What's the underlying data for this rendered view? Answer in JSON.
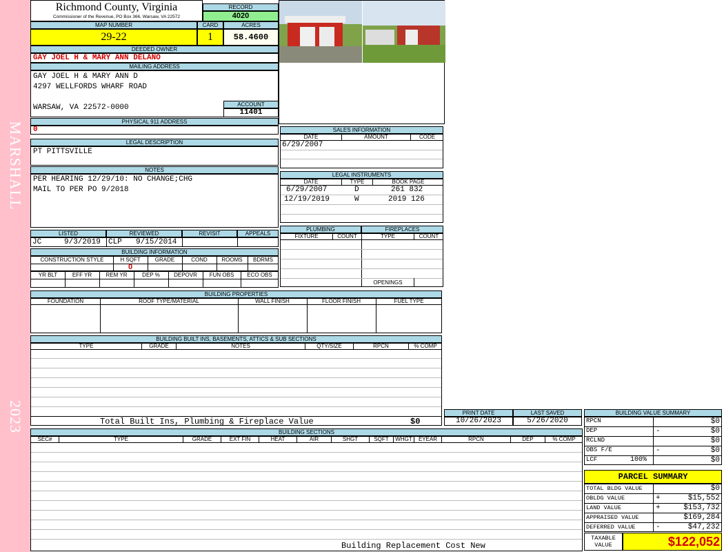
{
  "sidebar": {
    "district": "MARSHALL",
    "year": "2023"
  },
  "header": {
    "county": "Richmond County, Virginia",
    "commissioner": "Commissioner of the Revenue, PO Box 366, Warsaw, VA 22572",
    "record_label": "RECORD",
    "record": "4020",
    "map_label": "MAP NUMBER",
    "map_number": "29-22",
    "card_label": "CARD",
    "card": "1",
    "acres_label": "ACRES",
    "acres": "58.4600"
  },
  "owner": {
    "label": "DEEDED OWNER",
    "name": "GAY JOEL H & MARY ANN DELANO"
  },
  "mailing": {
    "label": "MAILING ADDRESS",
    "line1": "GAY JOEL H & MARY ANN D",
    "line2": "4297 WELLFORDS WHARF ROAD",
    "line3": "WARSAW, VA 22572-0000",
    "account_label": "ACCOUNT",
    "account": "11401"
  },
  "physical": {
    "label": "PHYSICAL 911 ADDRESS",
    "value": "0"
  },
  "legal": {
    "label": "LEGAL DESCRIPTION",
    "value": "PT PITTSVILLE"
  },
  "notes": {
    "label": "NOTES",
    "line1": "PER HEARING 12/29/10: NO CHANGE;CHG",
    "line2": "MAIL TO PER PO 9/2018"
  },
  "listed": {
    "listed_label": "LISTED",
    "reviewed_label": "REVIEWED",
    "revisit_label": "REVISIT",
    "appeals_label": "APPEALS",
    "listed_by": "JC",
    "listed_date": "9/3/2019",
    "reviewed_by": "CLP",
    "reviewed_date": "9/15/2014"
  },
  "building_info": {
    "label": "BUILDING INFORMATION",
    "cols": [
      "CONSTRUCTION STYLE",
      "H SQFT",
      "GRADE",
      "COND",
      "ROOMS",
      "BDRMS"
    ],
    "hsqft": "0",
    "cols2": [
      "YR BLT",
      "EFF YR",
      "REM YR",
      "DEP %",
      "DEPOVR",
      "FUN OBS",
      "ECO OBS"
    ]
  },
  "sales": {
    "label": "SALES INFORMATION",
    "cols": [
      "DATE",
      "AMOUNT",
      "CODE"
    ],
    "rows": [
      {
        "date": "6/29/2007"
      }
    ]
  },
  "instruments": {
    "label": "LEGAL INSTRUMENTS",
    "cols": [
      "DATE",
      "TYPE",
      "BOOK PAGE"
    ],
    "rows": [
      {
        "date": "6/29/2007",
        "type": "D",
        "book": "261 832"
      },
      {
        "date": "12/19/2019",
        "type": "W",
        "book": "2019 126"
      }
    ]
  },
  "plumbing": {
    "label": "PLUMBING",
    "fixture": "FIXTURE",
    "count": "COUNT"
  },
  "fireplaces": {
    "label": "FIREPLACES",
    "type": "TYPE",
    "count": "COUNT",
    "openings": "OPENINGS"
  },
  "properties": {
    "label": "BUILDING PROPERTIES",
    "cols": [
      "FOUNDATION",
      "ROOF TYPE/MATERIAL",
      "WALL FINISH",
      "FLOOR FINISH",
      "FUEL TYPE"
    ]
  },
  "builtins": {
    "label": "BUILDING BUILT INS, BASEMENTS, ATTICS & SUB SECTIONS",
    "cols": [
      "TYPE",
      "GRADE",
      "NOTES",
      "QTY/SIZE",
      "RPCN",
      "% COMP"
    ],
    "total_label": "Total Built Ins, Plumbing & Fireplace Value",
    "total": "$0"
  },
  "dates": {
    "print_label": "PRINT DATE",
    "print": "10/26/2023",
    "saved_label": "LAST SAVED",
    "saved": "5/26/2020"
  },
  "sections": {
    "label": "BUILDING SECTIONS",
    "cols": [
      "SEC#",
      "TYPE",
      "GRADE",
      "EXT FIN",
      "HEAT",
      "AIR",
      "SHGT",
      "SQFT",
      "WHGT",
      "EYEAR",
      "RPCN",
      "DEP",
      "% COMP"
    ],
    "footer": "Building Replacement Cost New"
  },
  "bvs": {
    "label": "BUILDING VALUE SUMMARY",
    "rows": [
      {
        "label": "RPCN",
        "sign": "",
        "value": "$0"
      },
      {
        "label": "DEP",
        "sign": "-",
        "value": "$0"
      },
      {
        "label": "RCLND",
        "sign": "",
        "value": "$0"
      },
      {
        "label": "OBS F/E",
        "sign": "-",
        "value": "$0"
      },
      {
        "label": "LCF",
        "pct": "100%",
        "sign": "",
        "value": "$0"
      }
    ]
  },
  "parcel": {
    "label": "PARCEL SUMMARY",
    "rows": [
      {
        "label": "TOTAL BLDG VALUE",
        "sign": "",
        "value": "$0"
      },
      {
        "label": "OBLDG VALUE",
        "sign": "+",
        "value": "$15,552"
      },
      {
        "label": "LAND VALUE",
        "sign": "+",
        "value": "$153,732"
      },
      {
        "label": "APPRAISED VALUE",
        "sign": "",
        "value": "$169,284"
      },
      {
        "label": "DEFERRED VALUE",
        "sign": "-",
        "value": "$47,232"
      }
    ],
    "taxable_label1": "TAXABLE",
    "taxable_label2": "VALUE",
    "taxable": "$122,052"
  },
  "colors": {
    "sidebar": "#ffc0cb",
    "header": "#add8e6",
    "yellow": "#ffff00",
    "green": "#90ee90",
    "red": "#d00000"
  }
}
